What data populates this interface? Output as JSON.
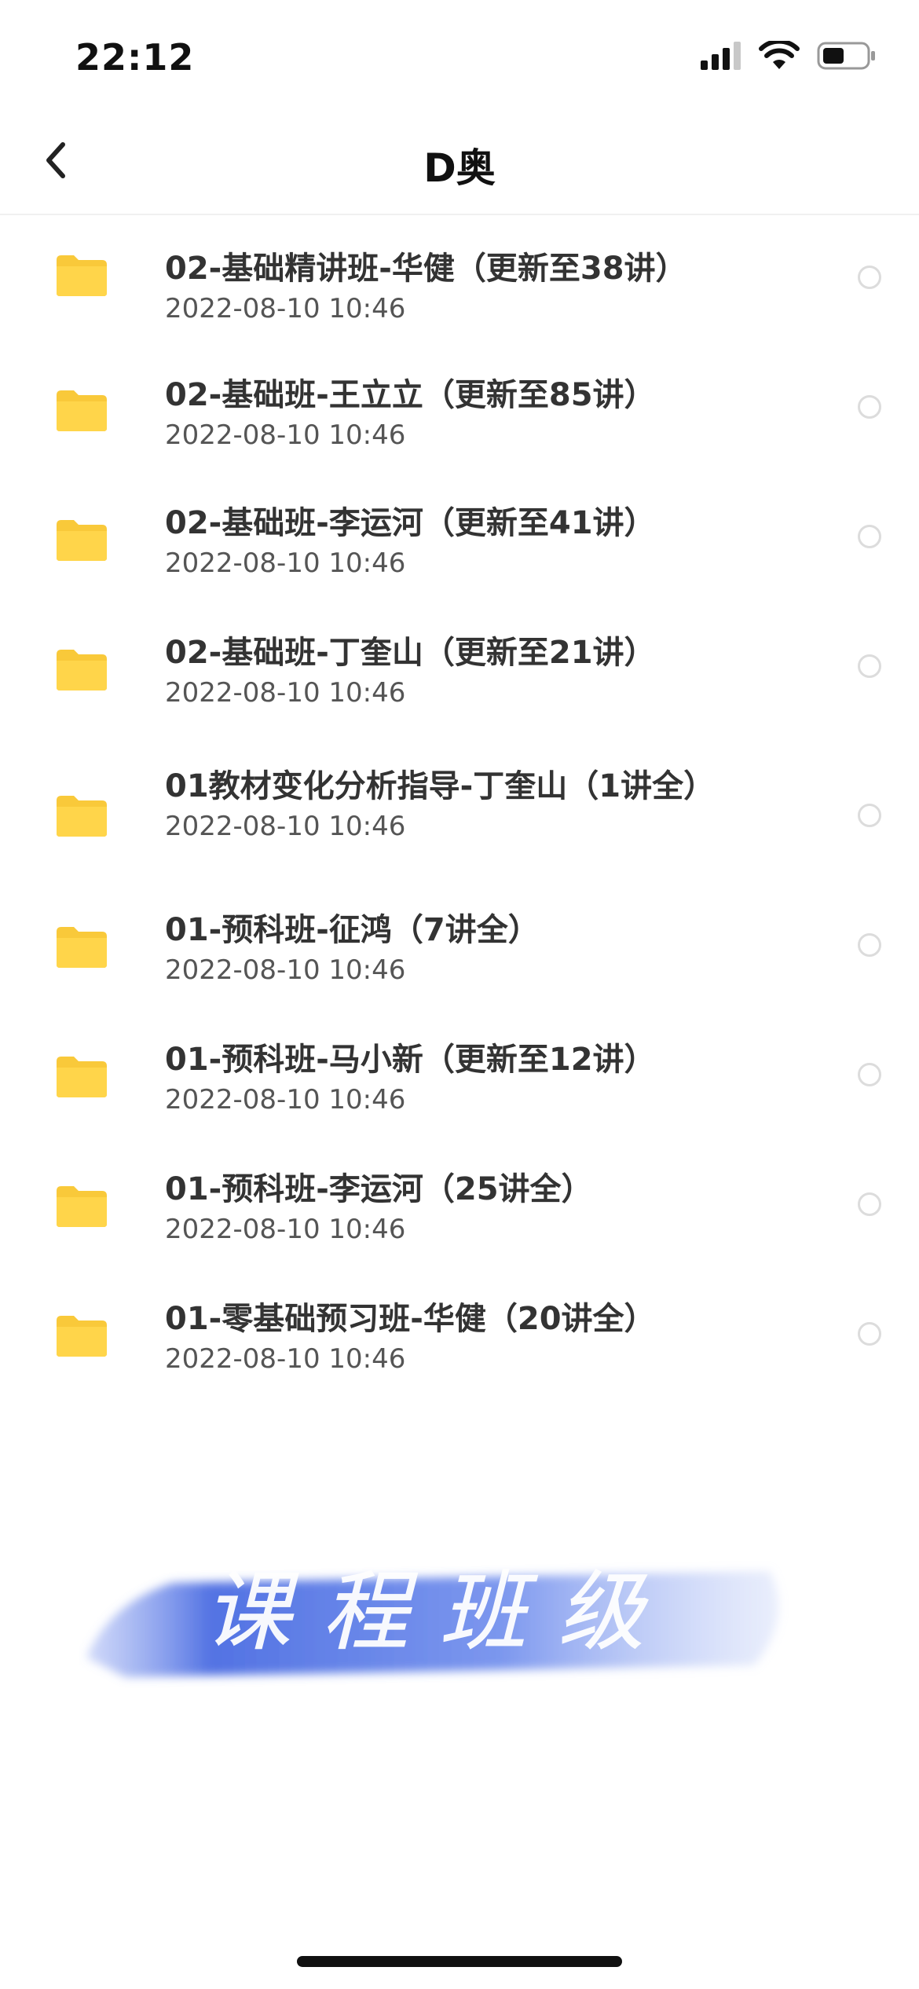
{
  "status_bar": {
    "time": "22:12"
  },
  "nav": {
    "title": "D奥"
  },
  "files": [
    {
      "name": "02-基础精讲班-华健（更新至38讲）",
      "date": "2022-08-10 10:46"
    },
    {
      "name": "02-基础班-王立立（更新至85讲）",
      "date": "2022-08-10 10:46"
    },
    {
      "name": "02-基础班-李运河（更新至41讲）",
      "date": "2022-08-10 10:46"
    },
    {
      "name": "02-基础班-丁奎山（更新至21讲）",
      "date": "2022-08-10 10:46"
    },
    {
      "name": "01教材变化分析指导-丁奎山（1讲全）",
      "date": "2022-08-10 10:46"
    },
    {
      "name": "01-预科班-征鸿（7讲全）",
      "date": "2022-08-10 10:46"
    },
    {
      "name": "01-预科班-马小新（更新至12讲）",
      "date": "2022-08-10 10:46"
    },
    {
      "name": "01-预科班-李运河（25讲全）",
      "date": "2022-08-10 10:46"
    },
    {
      "name": "01-零基础预习班-华健（20讲全）",
      "date": "2022-08-10 10:46"
    }
  ],
  "watermark": {
    "text": "课程班级"
  },
  "colors": {
    "folder": "#FFD54A",
    "folder_tab": "#F9C93A",
    "watermark_blue": "#3F63E0"
  },
  "icons": {
    "back": "chevron-left-icon",
    "folder": "folder-icon",
    "signal": "signal-icon",
    "wifi": "wifi-icon",
    "battery": "battery-icon"
  }
}
